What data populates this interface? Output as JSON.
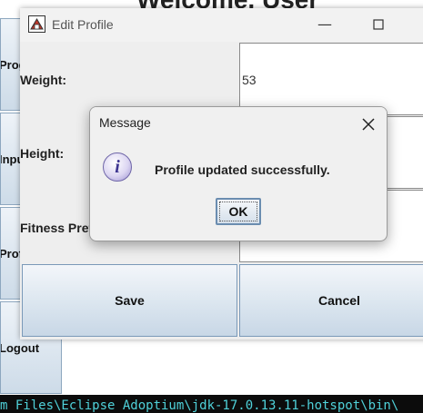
{
  "background_window": {
    "title": "Welcome, User",
    "sidebar": [
      {
        "label": "Progress"
      },
      {
        "label": "Input Data"
      },
      {
        "label": "Profile"
      },
      {
        "label": "Logout"
      }
    ]
  },
  "terminal": {
    "text": "m Files\\Eclipse Adoptium\\jdk-17.0.13.11-hotspot\\bin\\"
  },
  "edit_window": {
    "title": "Edit Profile",
    "fields": [
      {
        "label": "Weight:",
        "value": "53"
      },
      {
        "label": "Height:",
        "value": ""
      },
      {
        "label": "Fitness Preference:",
        "value": ""
      }
    ],
    "save_label": "Save",
    "cancel_label": "Cancel"
  },
  "dialog": {
    "title": "Message",
    "message": "Profile updated successfully.",
    "ok_label": "OK",
    "icon": "info-icon"
  }
}
